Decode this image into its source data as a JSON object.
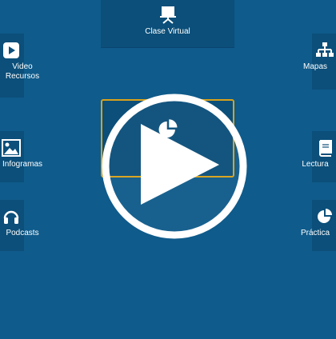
{
  "colors": {
    "background": "#0f5b8b",
    "tile": "#0b4f7a",
    "accent_border": "#d9a21b",
    "icon": "#ffffff"
  },
  "tiles": {
    "clase_virtual": {
      "label": "Clase Virtual",
      "icon": "projector-screen-icon"
    },
    "video_recursos": {
      "label": "Video\nRecursos",
      "icon": "play-icon"
    },
    "infogramas": {
      "label": "Infogramas",
      "icon": "image-icon"
    },
    "podcasts": {
      "label": "Podcasts",
      "icon": "headphones-icon"
    },
    "mapas": {
      "label": "Mapas",
      "icon": "sitemap-icon"
    },
    "lecturas": {
      "label": "Lectura",
      "icon": "book-icon"
    },
    "practicas": {
      "label": "Práctica",
      "icon": "pie-chart-icon"
    },
    "center": {
      "icon": "pie-chart-icon"
    }
  },
  "overlay": {
    "icon": "play-icon"
  }
}
